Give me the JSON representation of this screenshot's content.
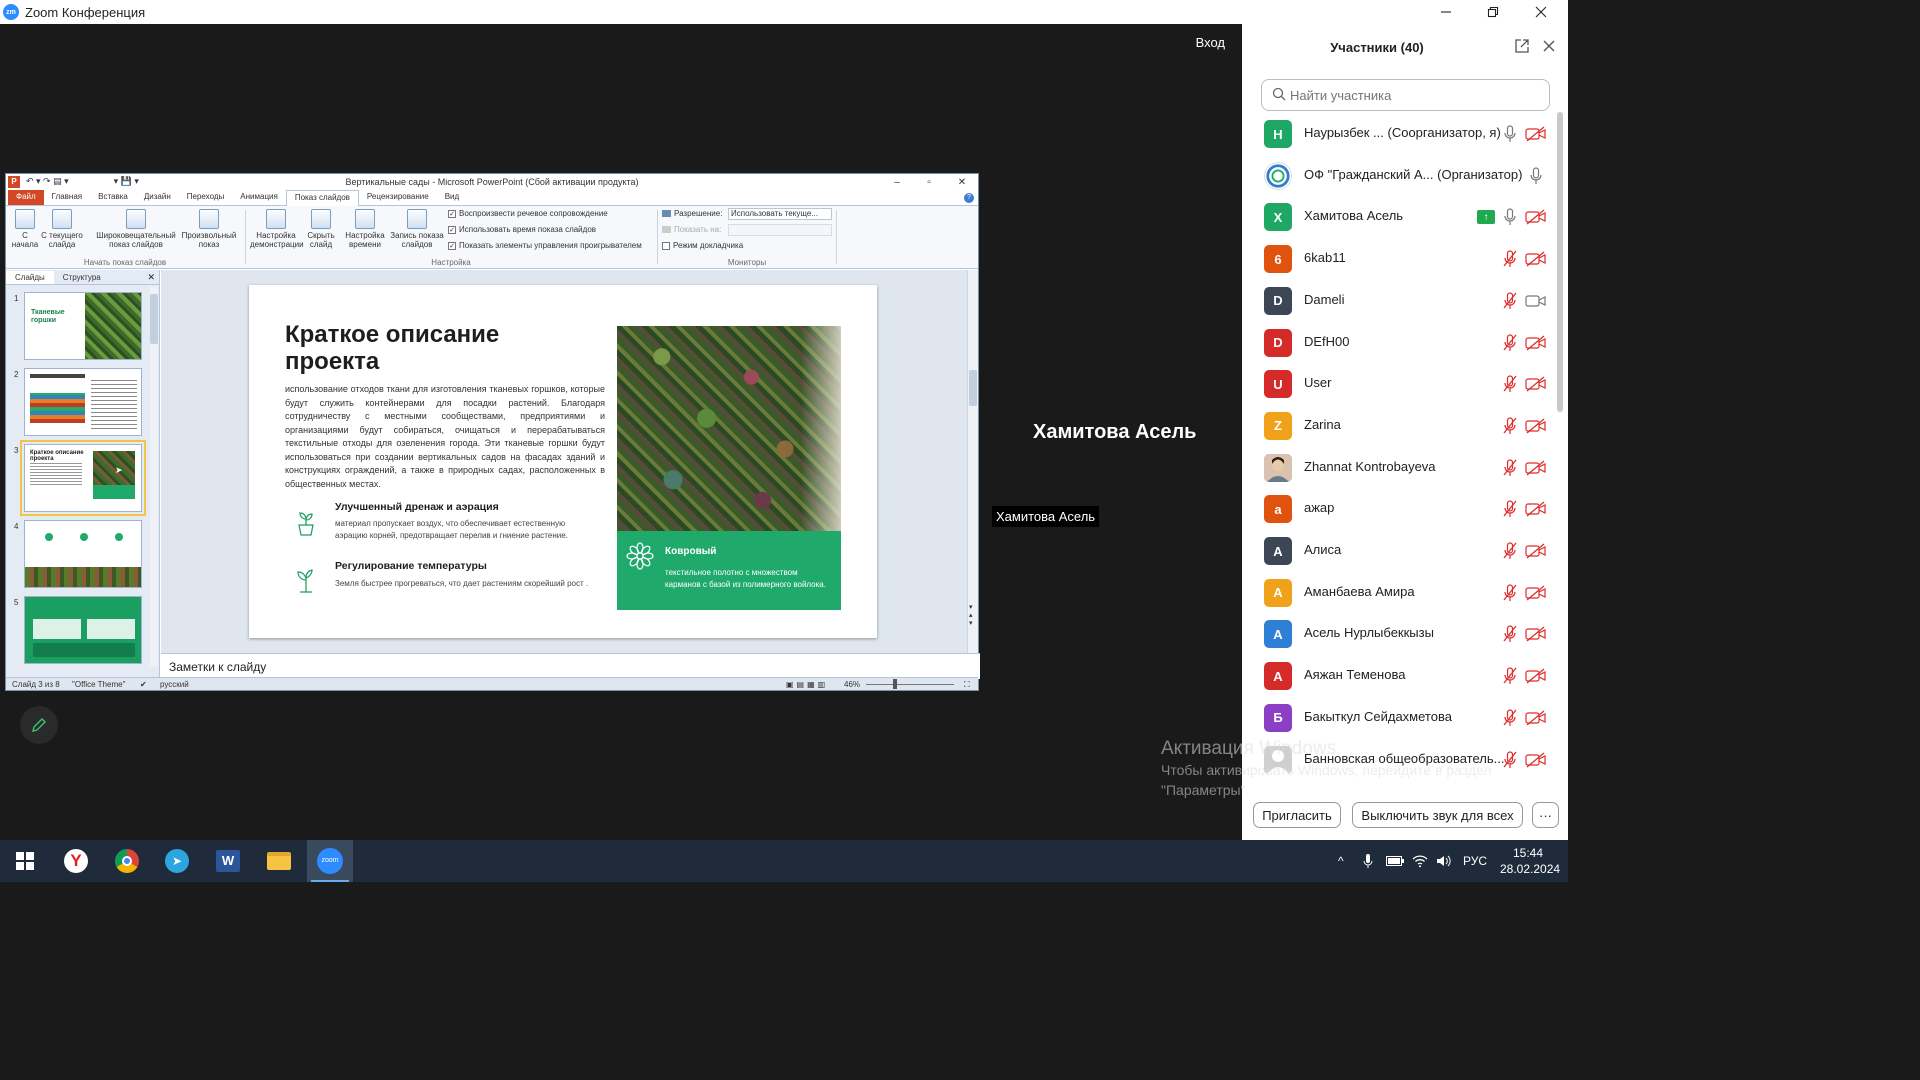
{
  "window": {
    "title": "Zoom Конференция",
    "logo_text": "zm"
  },
  "meeting": {
    "enter_label": "Вход",
    "speaker_name": "Хамитова Асель",
    "speaker_tag": "Хамитова Асель"
  },
  "ppt": {
    "title": "Вертикальные сады - Microsoft PowerPoint (Сбой активации продукта)",
    "tabs": [
      "Файл",
      "Главная",
      "Вставка",
      "Дизайн",
      "Переходы",
      "Анимация",
      "Показ слайдов",
      "Рецензирование",
      "Вид"
    ],
    "ribbon": {
      "btn_from_start": "С начала",
      "btn_from_current": "С текущего слайда",
      "btn_broadcast": "Широковещательный показ слайдов",
      "btn_custom": "Произвольный показ",
      "group_start": "Начать показ слайдов",
      "btn_setup": "Настройка демонстрации",
      "btn_hide": "Скрыть слайд",
      "btn_timing": "Настройка времени",
      "btn_record": "Запись показа слайдов",
      "chk_narration": "Воспроизвести речевое сопровождение",
      "chk_timings": "Использовать время показа слайдов",
      "chk_controls": "Показать элементы управления проигрывателем",
      "group_setup": "Настройка",
      "resolution_label": "Разрешение:",
      "resolution_value": "Использовать текуще...",
      "show_on_label": "Показать на:",
      "presenter_view": "Режим докладчика",
      "group_monitors": "Мониторы"
    },
    "pane_tabs": [
      "Слайды",
      "Структура"
    ],
    "thumb_numbers": [
      "1",
      "2",
      "3",
      "4",
      "5"
    ],
    "slide": {
      "title": "Краткое описание проекта",
      "body": "использование отходов ткани для изготовления тканевых горшков, которые будут служить контейнерами для посадки растений. Благодаря сотрудничеству с местными сообществами, предприятиями и организациями будут собираться, очищаться и перерабатываться текстильные отходы для озеленения города. Эти тканевые горшки будут использоваться при создании вертикальных садов на фасадах зданий и конструкциях ограждений, а также в природных садах, расположенных в общественных местах.",
      "feature1_title": "Улучшенный дренаж и аэрация",
      "feature1_text": "материал пропускает воздух, что обеспечивает естественную аэрацию корней, предотвращает перелив и гниение растение.",
      "feature2_title": "Регулирование температуры",
      "feature2_text": "Земля быстрее прогреваться, что дает растениям скорейший рост .",
      "card_title": "Ковровый",
      "card_text": "текстильное полотно с множеством карманов с базой из полимерного войлока."
    },
    "notes_placeholder": "Заметки к слайду",
    "status": {
      "slide_info": "Слайд 3 из 8",
      "theme": "\"Office Theme\"",
      "language": "русский",
      "zoom": "46%"
    }
  },
  "participants": {
    "header": "Участники (40)",
    "search_placeholder": "Найти участника",
    "list": [
      {
        "initial": "Н",
        "color": "#1fa865",
        "name": "Наурызбек ... (Соорганизатор, я)",
        "mic": "on",
        "cam": "off"
      },
      {
        "initial": "",
        "color": "#ffffff",
        "name": "ОФ \"Гражданский А... (Организатор)",
        "mic": "on",
        "cam": "none"
      },
      {
        "initial": "Х",
        "color": "#1fa865",
        "name": "Хамитова Асель",
        "mic": "on",
        "cam": "off",
        "sharing": true
      },
      {
        "initial": "6",
        "color": "#e0530f",
        "name": "6kab11",
        "mic": "muted",
        "cam": "off"
      },
      {
        "initial": "D",
        "color": "#3d4654",
        "name": "Dameli",
        "mic": "muted",
        "cam": "video"
      },
      {
        "initial": "D",
        "color": "#d42a2a",
        "name": "DEfH00",
        "mic": "muted",
        "cam": "off"
      },
      {
        "initial": "U",
        "color": "#d42a2a",
        "name": "User",
        "mic": "muted",
        "cam": "off"
      },
      {
        "initial": "Z",
        "color": "#f0a21b",
        "name": "Zarina",
        "mic": "muted",
        "cam": "off"
      },
      {
        "initial": "",
        "color": "#c9a48a",
        "name": "Zhannat Kontrobayeva",
        "mic": "muted",
        "cam": "off"
      },
      {
        "initial": "а",
        "color": "#e0530f",
        "name": "ажар",
        "mic": "muted",
        "cam": "off"
      },
      {
        "initial": "А",
        "color": "#3d4654",
        "name": "Алиса",
        "mic": "muted",
        "cam": "off"
      },
      {
        "initial": "А",
        "color": "#f0a21b",
        "name": "Аманбаева Амира",
        "mic": "muted",
        "cam": "off"
      },
      {
        "initial": "А",
        "color": "#2f7fd6",
        "name": "Асель Нурлыбеккызы",
        "mic": "muted",
        "cam": "off"
      },
      {
        "initial": "А",
        "color": "#d42a2a",
        "name": "Аяжан Теменова",
        "mic": "muted",
        "cam": "off"
      },
      {
        "initial": "Б",
        "color": "#8a3fc4",
        "name": "Бакыткул Сейдахметова",
        "mic": "muted",
        "cam": "off"
      },
      {
        "initial": "",
        "color": "#cfcfcf",
        "name": "Банновская общеобразователь...",
        "mic": "muted",
        "cam": "off"
      }
    ],
    "invite_label": "Пригласить",
    "mute_all_label": "Выключить звук для всех",
    "more_label": "···"
  },
  "watermark": {
    "title": "Активация Windows",
    "text": "Чтобы активировать Windows, перейдите в раздел \"Параметры\"."
  },
  "taskbar": {
    "lang": "РУС",
    "time": "15:44",
    "date": "28.02.2024",
    "apps": [
      "windows-start",
      "yandex-browser",
      "chrome",
      "telegram",
      "word",
      "file-explorer",
      "zoom"
    ]
  }
}
